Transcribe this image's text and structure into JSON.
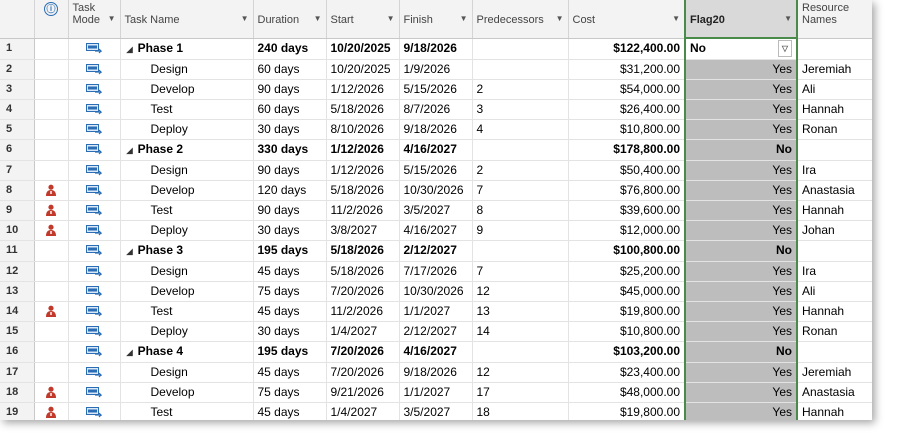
{
  "columns": {
    "info": "ⓘ",
    "mode": "Task Mode",
    "name": "Task Name",
    "duration": "Duration",
    "start": "Start",
    "finish": "Finish",
    "pred": "Predecessors",
    "cost": "Cost",
    "flag": "Flag20",
    "res": "Resource Names"
  },
  "rows": [
    {
      "id": "1",
      "summary": true,
      "person": false,
      "name": "Phase 1",
      "duration": "240 days",
      "start": "10/20/2025",
      "finish": "9/18/2026",
      "pred": "",
      "cost": "$122,400.00",
      "flag": "No",
      "res": ""
    },
    {
      "id": "2",
      "summary": false,
      "person": false,
      "name": "Design",
      "duration": "60 days",
      "start": "10/20/2025",
      "finish": "1/9/2026",
      "pred": "",
      "cost": "$31,200.00",
      "flag": "Yes",
      "res": "Jeremiah"
    },
    {
      "id": "3",
      "summary": false,
      "person": false,
      "name": "Develop",
      "duration": "90 days",
      "start": "1/12/2026",
      "finish": "5/15/2026",
      "pred": "2",
      "cost": "$54,000.00",
      "flag": "Yes",
      "res": "Ali"
    },
    {
      "id": "4",
      "summary": false,
      "person": false,
      "name": "Test",
      "duration": "60 days",
      "start": "5/18/2026",
      "finish": "8/7/2026",
      "pred": "3",
      "cost": "$26,400.00",
      "flag": "Yes",
      "res": "Hannah"
    },
    {
      "id": "5",
      "summary": false,
      "person": false,
      "name": "Deploy",
      "duration": "30 days",
      "start": "8/10/2026",
      "finish": "9/18/2026",
      "pred": "4",
      "cost": "$10,800.00",
      "flag": "Yes",
      "res": "Ronan"
    },
    {
      "id": "6",
      "summary": true,
      "person": false,
      "name": "Phase 2",
      "duration": "330 days",
      "start": "1/12/2026",
      "finish": "4/16/2027",
      "pred": "",
      "cost": "$178,800.00",
      "flag": "No",
      "res": ""
    },
    {
      "id": "7",
      "summary": false,
      "person": false,
      "name": "Design",
      "duration": "90 days",
      "start": "1/12/2026",
      "finish": "5/15/2026",
      "pred": "2",
      "cost": "$50,400.00",
      "flag": "Yes",
      "res": "Ira"
    },
    {
      "id": "8",
      "summary": false,
      "person": true,
      "name": "Develop",
      "duration": "120 days",
      "start": "5/18/2026",
      "finish": "10/30/2026",
      "pred": "7",
      "cost": "$76,800.00",
      "flag": "Yes",
      "res": "Anastasia"
    },
    {
      "id": "9",
      "summary": false,
      "person": true,
      "name": "Test",
      "duration": "90 days",
      "start": "11/2/2026",
      "finish": "3/5/2027",
      "pred": "8",
      "cost": "$39,600.00",
      "flag": "Yes",
      "res": "Hannah"
    },
    {
      "id": "10",
      "summary": false,
      "person": true,
      "name": "Deploy",
      "duration": "30 days",
      "start": "3/8/2027",
      "finish": "4/16/2027",
      "pred": "9",
      "cost": "$12,000.00",
      "flag": "Yes",
      "res": "Johan"
    },
    {
      "id": "11",
      "summary": true,
      "person": false,
      "name": "Phase 3",
      "duration": "195 days",
      "start": "5/18/2026",
      "finish": "2/12/2027",
      "pred": "",
      "cost": "$100,800.00",
      "flag": "No",
      "res": ""
    },
    {
      "id": "12",
      "summary": false,
      "person": false,
      "name": "Design",
      "duration": "45 days",
      "start": "5/18/2026",
      "finish": "7/17/2026",
      "pred": "7",
      "cost": "$25,200.00",
      "flag": "Yes",
      "res": "Ira"
    },
    {
      "id": "13",
      "summary": false,
      "person": false,
      "name": "Develop",
      "duration": "75 days",
      "start": "7/20/2026",
      "finish": "10/30/2026",
      "pred": "12",
      "cost": "$45,000.00",
      "flag": "Yes",
      "res": "Ali"
    },
    {
      "id": "14",
      "summary": false,
      "person": true,
      "name": "Test",
      "duration": "45 days",
      "start": "11/2/2026",
      "finish": "1/1/2027",
      "pred": "13",
      "cost": "$19,800.00",
      "flag": "Yes",
      "res": "Hannah"
    },
    {
      "id": "15",
      "summary": false,
      "person": false,
      "name": "Deploy",
      "duration": "30 days",
      "start": "1/4/2027",
      "finish": "2/12/2027",
      "pred": "14",
      "cost": "$10,800.00",
      "flag": "Yes",
      "res": "Ronan"
    },
    {
      "id": "16",
      "summary": true,
      "person": false,
      "name": "Phase 4",
      "duration": "195 days",
      "start": "7/20/2026",
      "finish": "4/16/2027",
      "pred": "",
      "cost": "$103,200.00",
      "flag": "No",
      "res": ""
    },
    {
      "id": "17",
      "summary": false,
      "person": false,
      "name": "Design",
      "duration": "45 days",
      "start": "7/20/2026",
      "finish": "9/18/2026",
      "pred": "12",
      "cost": "$23,400.00",
      "flag": "Yes",
      "res": "Jeremiah"
    },
    {
      "id": "18",
      "summary": false,
      "person": true,
      "name": "Develop",
      "duration": "75 days",
      "start": "9/21/2026",
      "finish": "1/1/2027",
      "pred": "17",
      "cost": "$48,000.00",
      "flag": "Yes",
      "res": "Anastasia"
    },
    {
      "id": "19",
      "summary": false,
      "person": true,
      "name": "Test",
      "duration": "45 days",
      "start": "1/4/2027",
      "finish": "3/5/2027",
      "pred": "18",
      "cost": "$19,800.00",
      "flag": "Yes",
      "res": "Hannah"
    }
  ],
  "colors": {
    "flag_fill": "#bdbdbd",
    "flag_border": "#4a8a4a",
    "person_icon": "#c0392b",
    "mode_icon": "#2a6db5"
  },
  "icons": {
    "mode": "auto-schedule-icon",
    "person": "resource-overallocated-icon",
    "summary": "collapse-triangle-icon",
    "info": "info-icon"
  }
}
